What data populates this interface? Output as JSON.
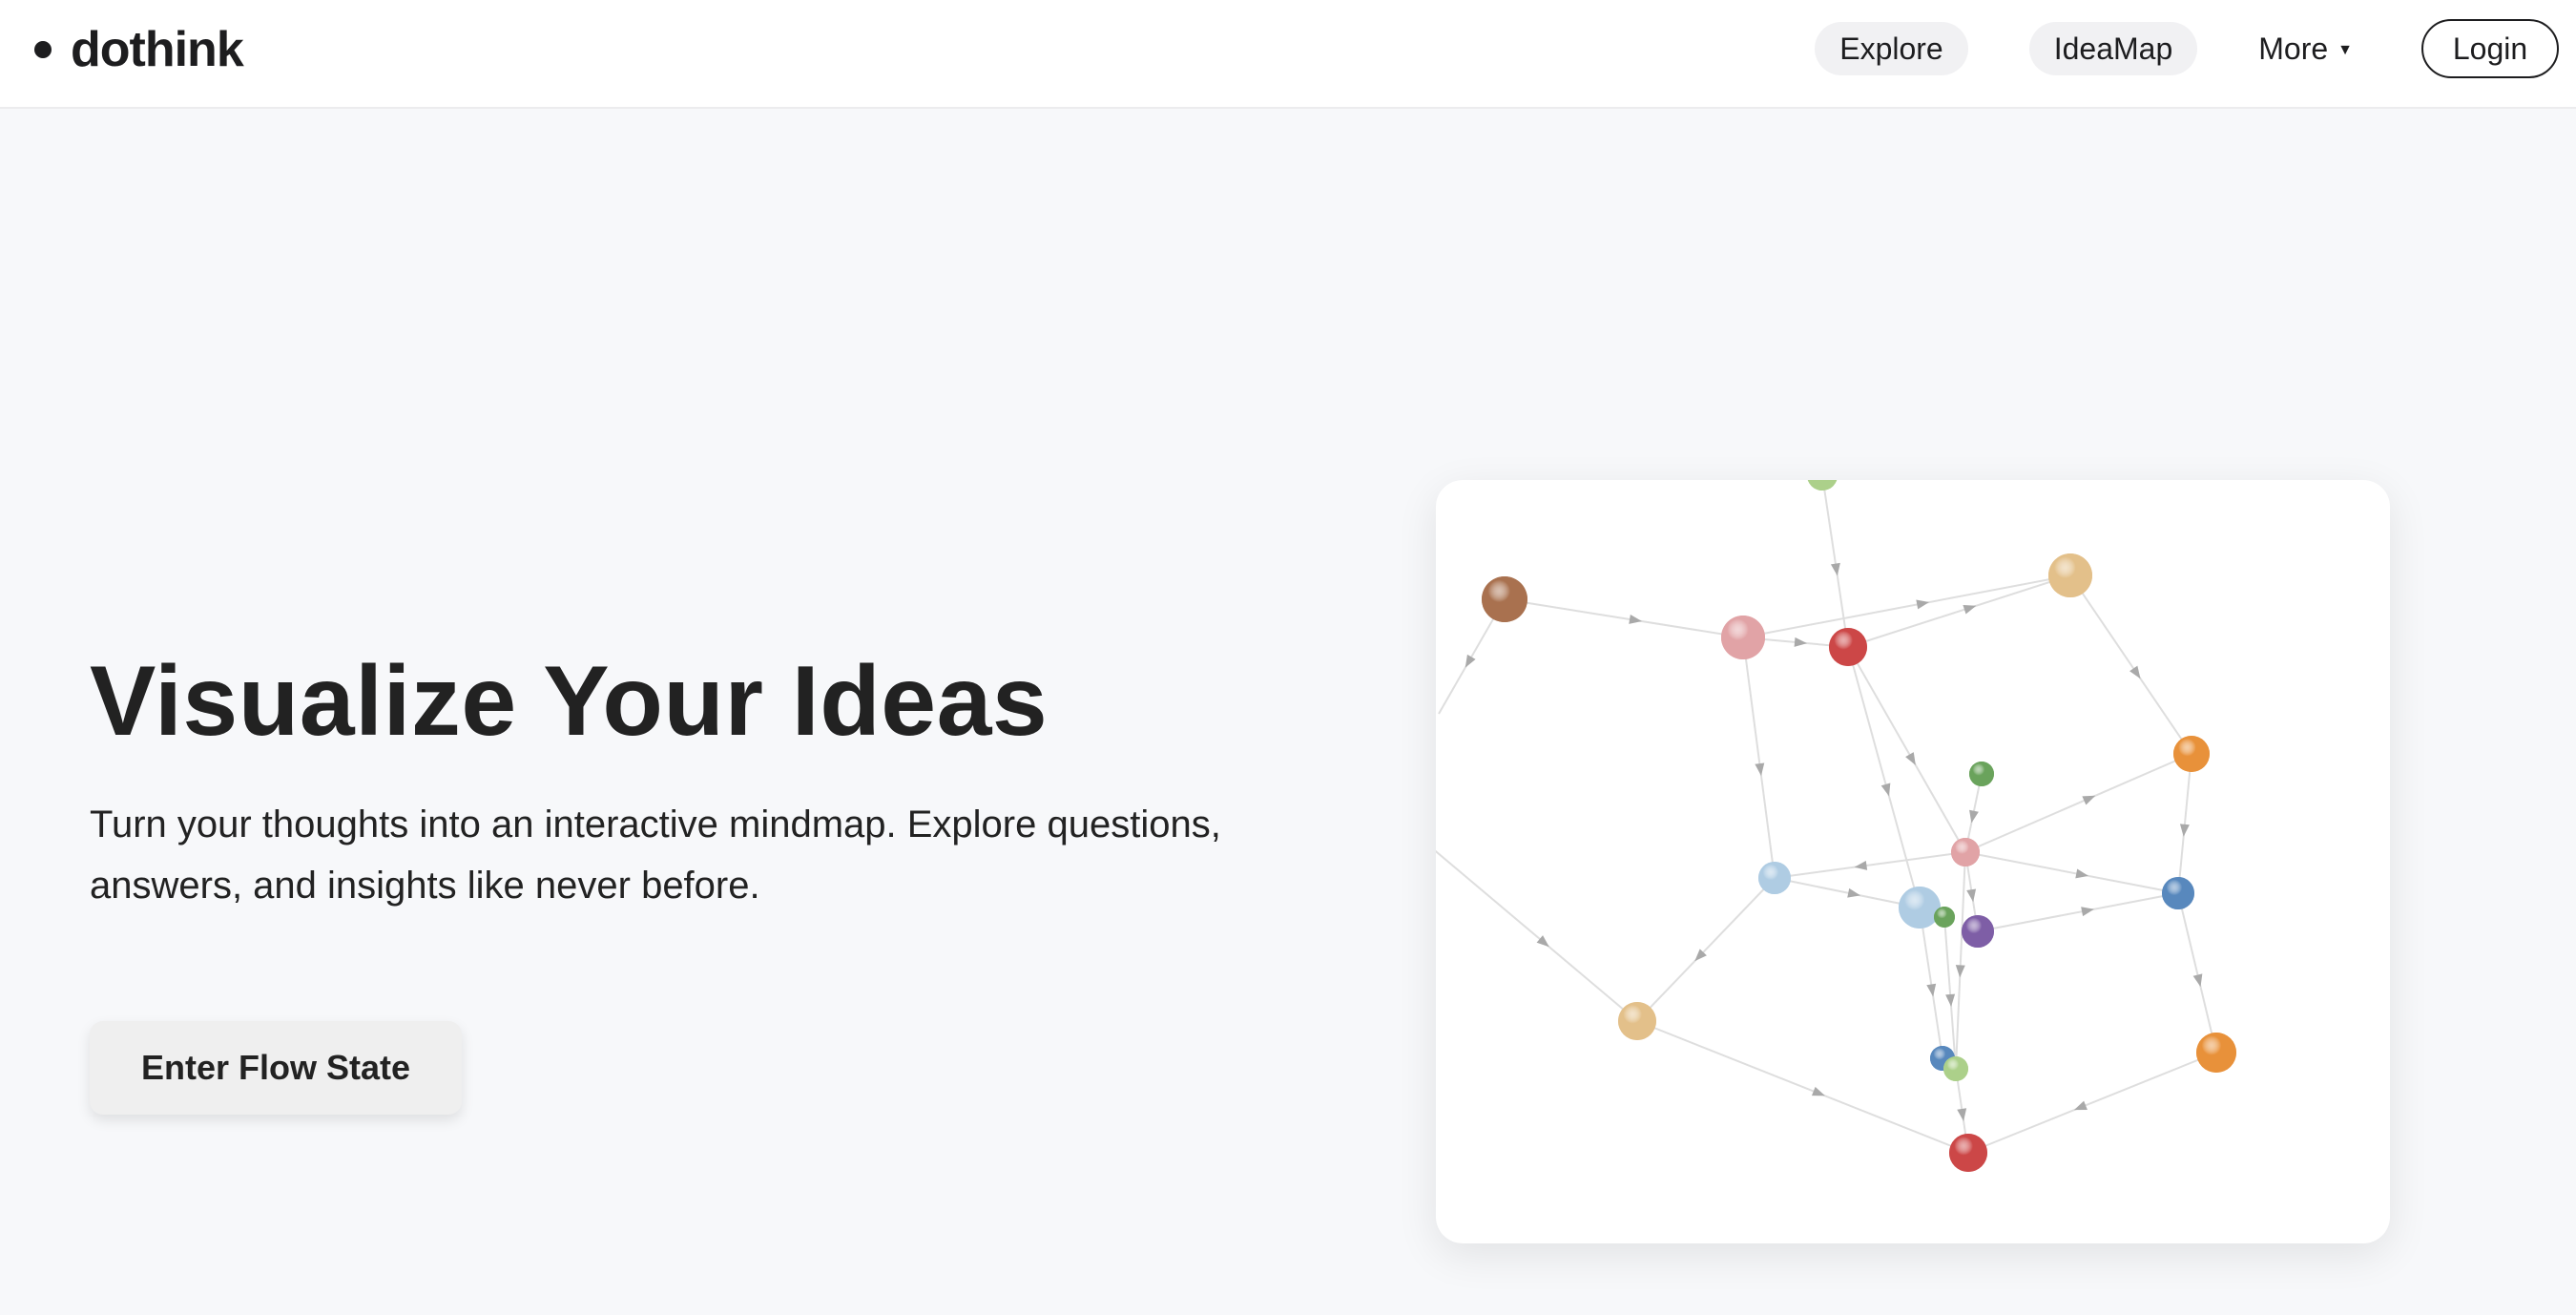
{
  "brand": {
    "name": "dothink"
  },
  "nav": {
    "explore": "Explore",
    "ideamap": "IdeaMap",
    "more": "More",
    "more_caret": "▼",
    "login": "Login"
  },
  "hero": {
    "title": "Visualize Your Ideas",
    "subtitle": "Turn your thoughts into an interactive mindmap. Explore questions, answers, and insights like never before.",
    "cta": "Enter Flow State"
  },
  "graph": {
    "colors": {
      "brown": "#a9714f",
      "pink": "#e1a3a6",
      "red": "#cc4747",
      "tan": "#e3c08a",
      "orange": "#e8913a",
      "green": "#6aa35c",
      "lightgreen": "#acd08a",
      "lightblue": "#afcce3",
      "blue": "#5888bd",
      "purple": "#7e5ea6",
      "edge": "#dedede",
      "arrow": "#a9a9a9"
    }
  }
}
